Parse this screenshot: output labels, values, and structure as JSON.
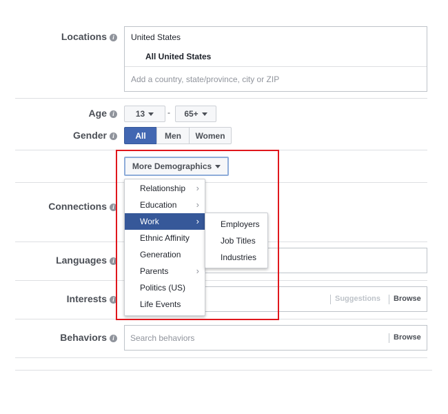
{
  "locations": {
    "label": "Locations",
    "country": "United States",
    "selected": "All United States",
    "placeholder": "Add a country, state/province, city or ZIP"
  },
  "age": {
    "label": "Age",
    "min": "13",
    "separator": "-",
    "max": "65+"
  },
  "gender": {
    "label": "Gender",
    "options": [
      "All",
      "Men",
      "Women"
    ],
    "selected": "All"
  },
  "more_demographics": {
    "button_label": "More Demographics",
    "menu_items": [
      "Relationship",
      "Education",
      "Work",
      "Ethnic Affinity",
      "Generation",
      "Parents",
      "Politics (US)",
      "Life Events"
    ],
    "highlighted": "Work",
    "submenu_items": [
      "Employers",
      "Job Titles",
      "Industries"
    ]
  },
  "connections": {
    "label": "Connections"
  },
  "languages": {
    "label": "Languages"
  },
  "interests": {
    "label": "Interests",
    "suggestions": "Suggestions",
    "browse": "Browse"
  },
  "behaviors": {
    "label": "Behaviors",
    "placeholder": "Search behaviors",
    "browse": "Browse"
  },
  "info_icon_glyph": "i",
  "highlight_color": "#e0161c",
  "accent_color": "#4267b2"
}
